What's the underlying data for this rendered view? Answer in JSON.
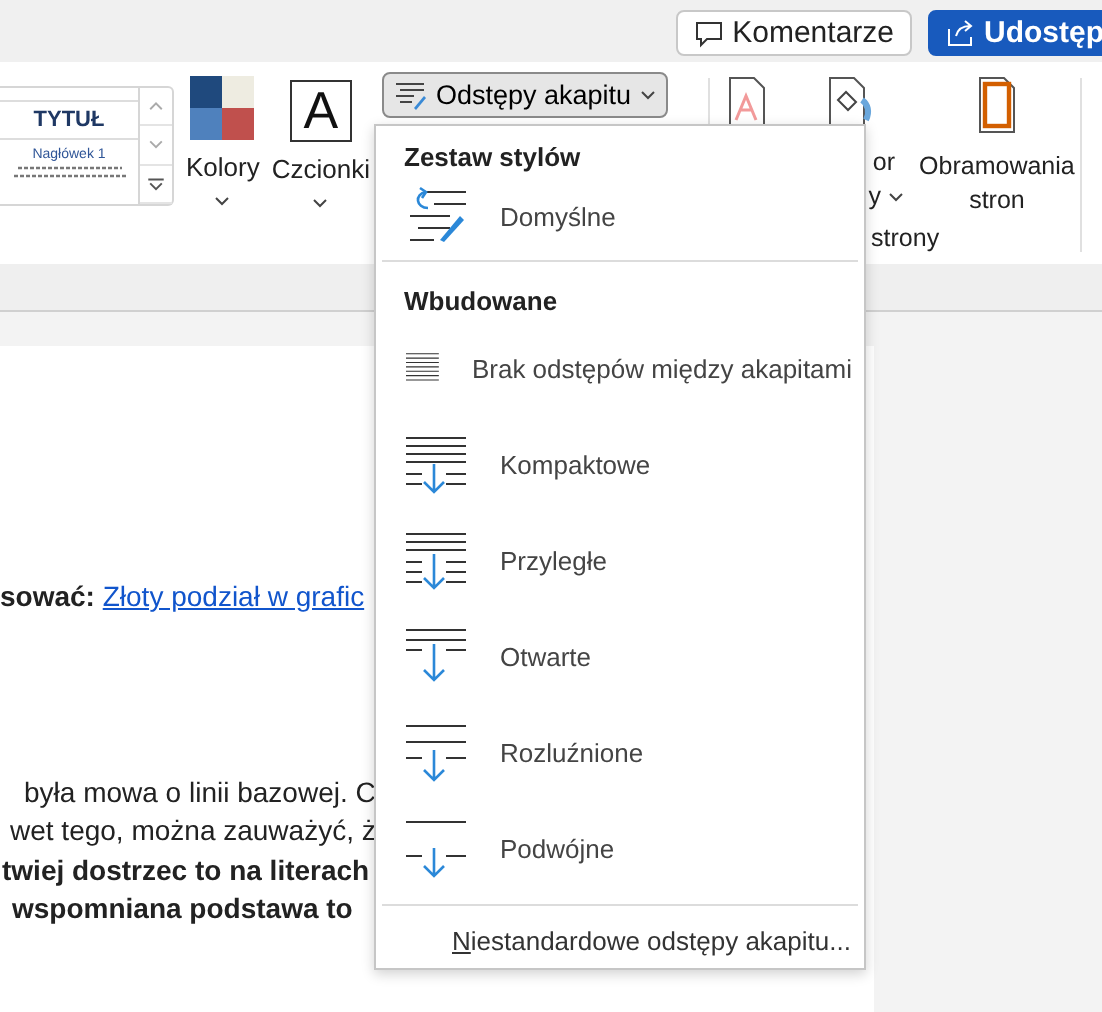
{
  "top_bar": {
    "buttons": [
      {
        "label": "Komentarze",
        "kind": "comment"
      },
      {
        "label": "Udostęp",
        "kind": "share"
      }
    ]
  },
  "ribbon": {
    "style_gallery": {
      "title": "TYTUŁ",
      "heading": "Nagłówek 1"
    },
    "commands": [
      {
        "label": "Kolory",
        "kind": "colors"
      },
      {
        "label": "Czcionki",
        "kind": "fonts",
        "glyph": "A"
      }
    ],
    "spacing_button": {
      "label": "Odstępy akapitu",
      "expanded": true
    },
    "page_background": {
      "commands": [
        {
          "kind": "watermark"
        },
        {
          "kind": "page-color",
          "lines": [
            "or",
            "y"
          ]
        },
        {
          "kind": "page-borders",
          "lines": [
            "Obramowania",
            "stron"
          ]
        }
      ],
      "group_label": "strony"
    }
  },
  "document": {
    "lines": [
      {
        "text": "sować:",
        "link": "Złoty podział w grafic",
        "bold": true
      },
      {
        "text": "była mowa o linii bazowej. C",
        "bold": false
      },
      {
        "text": "wet tego, można zauważyć, ż",
        "bold": false
      },
      {
        "text": "twiej dostrzec to na literach",
        "bold": true
      },
      {
        "text": "wspomniana podstawa to",
        "bold": true
      }
    ]
  },
  "spacing_menu": {
    "sections": [
      {
        "title": "Zestaw stylów",
        "items": [
          {
            "label": "Domyślne",
            "kind": "default"
          }
        ]
      },
      {
        "title": "Wbudowane",
        "items": [
          {
            "label": "Brak odstępów między akapitami",
            "kind": "none"
          },
          {
            "label": "Kompaktowe",
            "kind": "compact"
          },
          {
            "label": "Przyległe",
            "kind": "tight"
          },
          {
            "label": "Otwarte",
            "kind": "open"
          },
          {
            "label": "Rozluźnione",
            "kind": "relaxed"
          },
          {
            "label": "Podwójne",
            "kind": "double"
          }
        ]
      }
    ],
    "footer": {
      "access_key": "N",
      "rest": "iestandardowe odstępy akapitu..."
    }
  }
}
